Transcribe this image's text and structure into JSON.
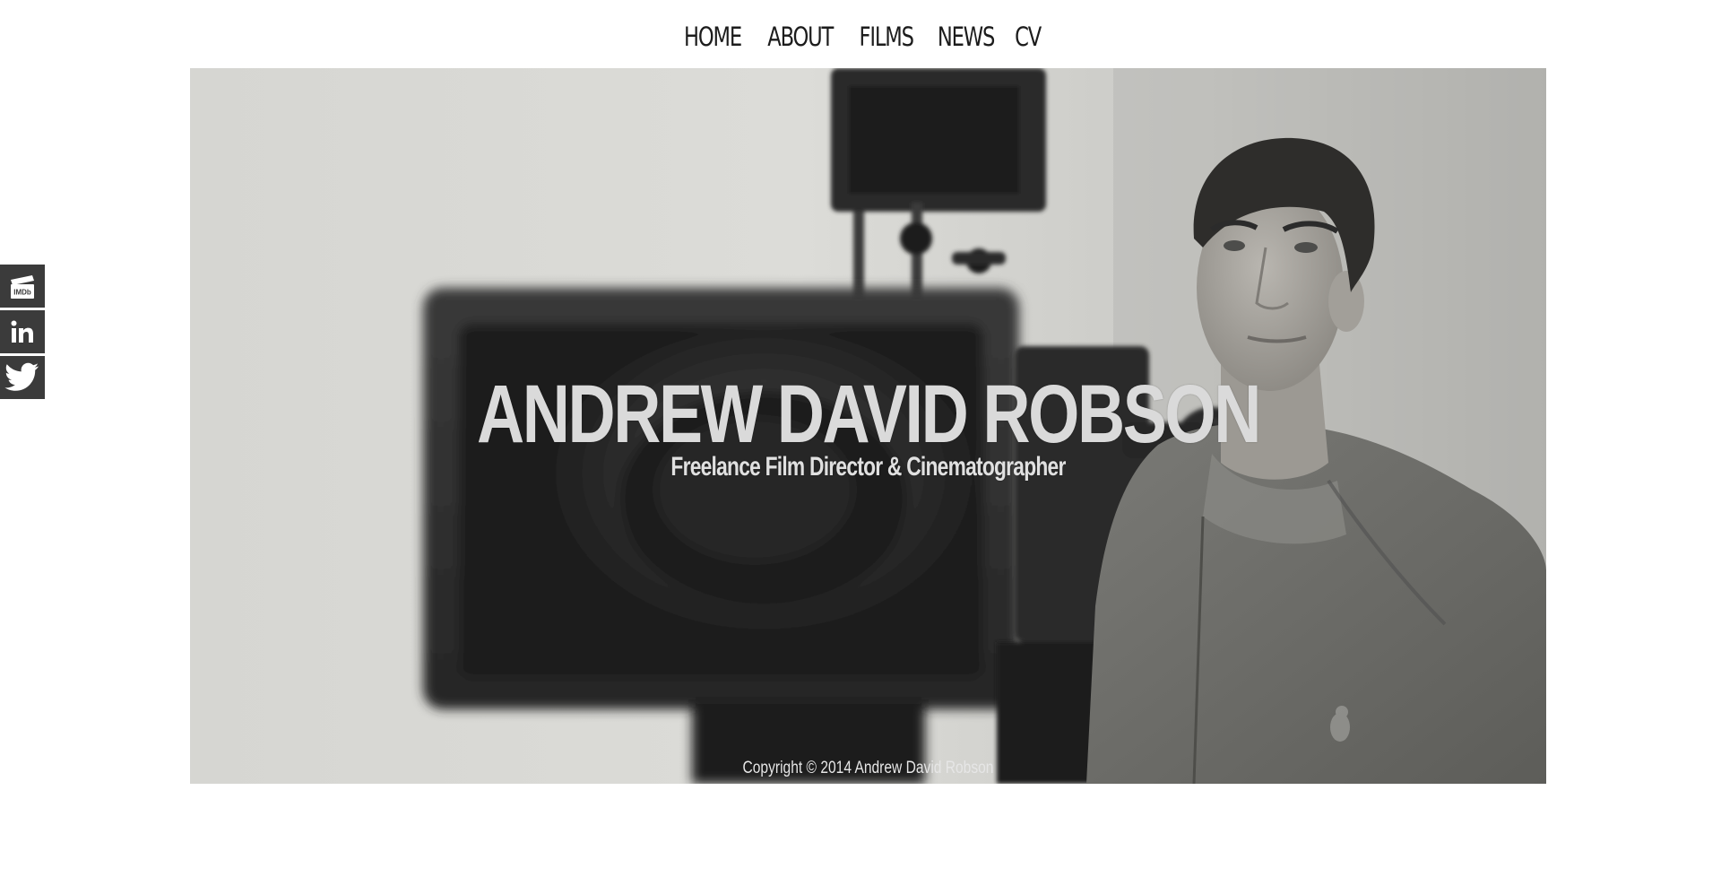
{
  "nav": {
    "items": [
      {
        "label": "HOME"
      },
      {
        "label": "ABOUT"
      },
      {
        "label": "FILMS"
      },
      {
        "label": "NEWS"
      },
      {
        "label": "CV"
      }
    ]
  },
  "social": {
    "items": [
      {
        "icon": "imdb-icon",
        "label": "IMDb"
      },
      {
        "icon": "linkedin-icon",
        "label": "in"
      },
      {
        "icon": "twitter-icon",
        "label": ""
      }
    ]
  },
  "hero": {
    "title": "ANDREW DAVID ROBSON",
    "subtitle": "Freelance Film Director & Cinematographer",
    "copyright": "Copyright © 2014 Andrew David Robson"
  },
  "colors": {
    "social_tile": "#3b3b3b",
    "nav_text": "#1c1c1c",
    "hero_text": "#dadada"
  }
}
